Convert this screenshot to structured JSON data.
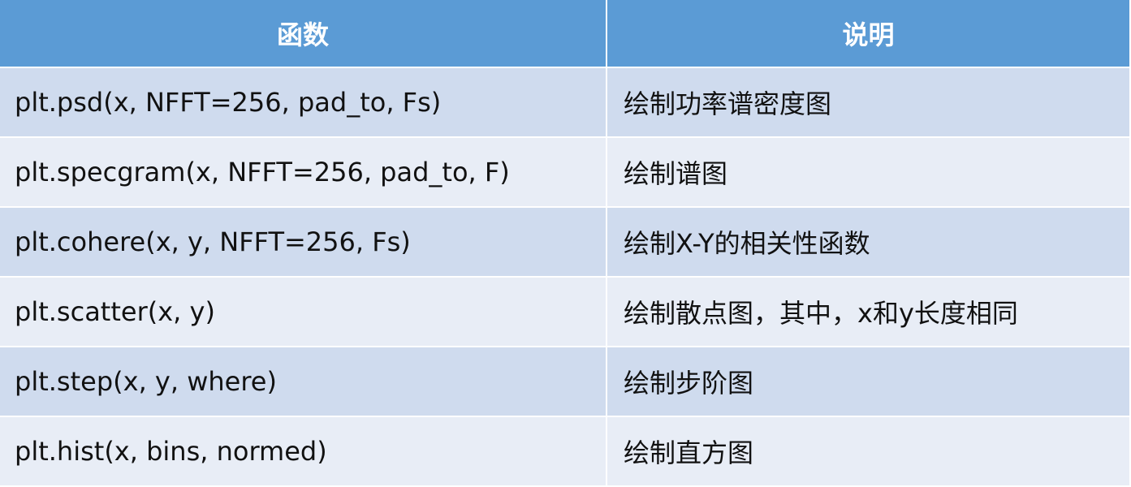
{
  "table": {
    "headers": [
      "函数",
      "说明"
    ],
    "rows": [
      {
        "function": "plt.psd(x, NFFT=256, pad_to, Fs)",
        "description": "绘制功率谱密度图"
      },
      {
        "function": "plt.specgram(x, NFFT=256, pad_to, F)",
        "description": "绘制谱图"
      },
      {
        "function": "plt.cohere(x, y, NFFT=256, Fs)",
        "description": "绘制X-Y的相关性函数"
      },
      {
        "function": "plt.scatter(x, y)",
        "description": "绘制散点图，其中，x和y长度相同"
      },
      {
        "function": "plt.step(x, y, where)",
        "description": "绘制步阶图"
      },
      {
        "function": "plt.hist(x, bins, normed)",
        "description": "绘制直方图"
      }
    ]
  },
  "colors": {
    "header_bg": "#5b9bd5",
    "row_odd_bg": "#cfdbee",
    "row_even_bg": "#e8edf6"
  }
}
